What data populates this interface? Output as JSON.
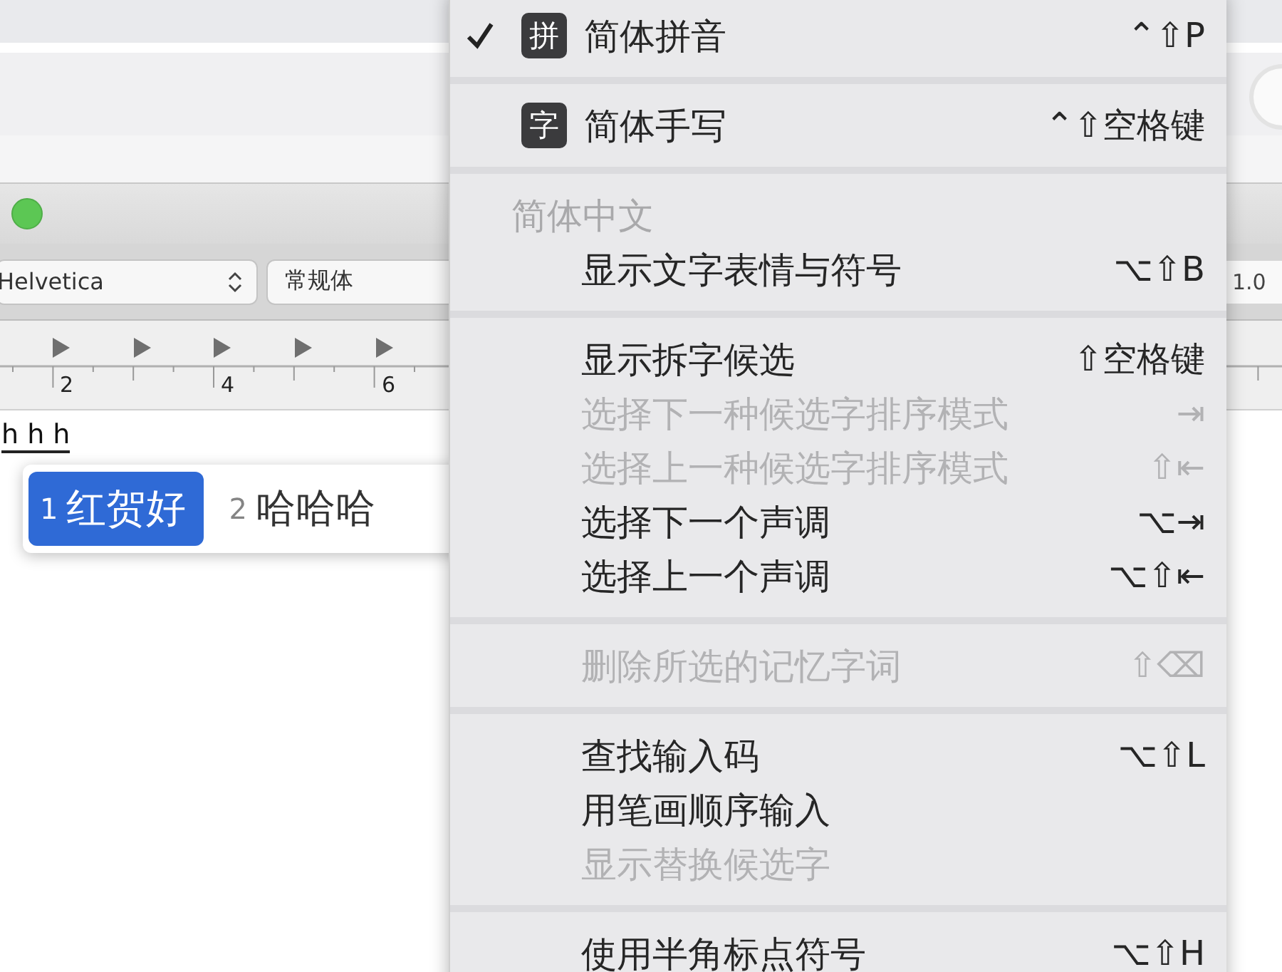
{
  "editor": {
    "font_family": "Helvetica",
    "font_style": "常规体",
    "line_spacing": "1.0",
    "ruler_labels": [
      "2",
      "4",
      "6"
    ],
    "marked_text": "h h h"
  },
  "candidates": [
    {
      "number": "1",
      "text": "红贺好",
      "selected": true
    },
    {
      "number": "2",
      "text": "哈哈哈",
      "selected": false
    }
  ],
  "menu": {
    "sections": [
      {
        "items": [
          {
            "kind": "input_source",
            "badge": "拼",
            "label": "简体拼音",
            "shortcut": "⌃⇧P",
            "checked": true
          }
        ]
      },
      {
        "items": [
          {
            "kind": "input_source",
            "badge": "字",
            "label": "简体手写",
            "shortcut": "⌃⇧空格键",
            "checked": false
          }
        ]
      },
      {
        "items": [
          {
            "kind": "header",
            "label": "简体中文"
          },
          {
            "kind": "command",
            "label": "显示文字表情与符号",
            "shortcut": "⌥⇧B",
            "disabled": false
          }
        ]
      },
      {
        "items": [
          {
            "kind": "command",
            "label": "显示拆字候选",
            "shortcut": "⇧空格键",
            "disabled": false
          },
          {
            "kind": "command",
            "label": "选择下一种候选字排序模式",
            "shortcut": "⇥",
            "disabled": true
          },
          {
            "kind": "command",
            "label": "选择上一种候选字排序模式",
            "shortcut": "⇧⇤",
            "disabled": true
          },
          {
            "kind": "command",
            "label": "选择下一个声调",
            "shortcut": "⌥⇥",
            "disabled": false
          },
          {
            "kind": "command",
            "label": "选择上一个声调",
            "shortcut": "⌥⇧⇤",
            "disabled": false
          }
        ]
      },
      {
        "items": [
          {
            "kind": "command",
            "label": "删除所选的记忆字词",
            "shortcut": "⇧⌫",
            "disabled": true
          }
        ]
      },
      {
        "items": [
          {
            "kind": "command",
            "label": "查找输入码",
            "shortcut": "⌥⇧L",
            "disabled": false
          },
          {
            "kind": "command",
            "label": "用笔画顺序输入",
            "disabled": false
          },
          {
            "kind": "command",
            "label": "显示替换候选字",
            "disabled": true
          }
        ]
      },
      {
        "items": [
          {
            "kind": "command",
            "label": "使用半角标点符号",
            "shortcut": "⌥⇧H",
            "disabled": false
          }
        ]
      }
    ]
  }
}
